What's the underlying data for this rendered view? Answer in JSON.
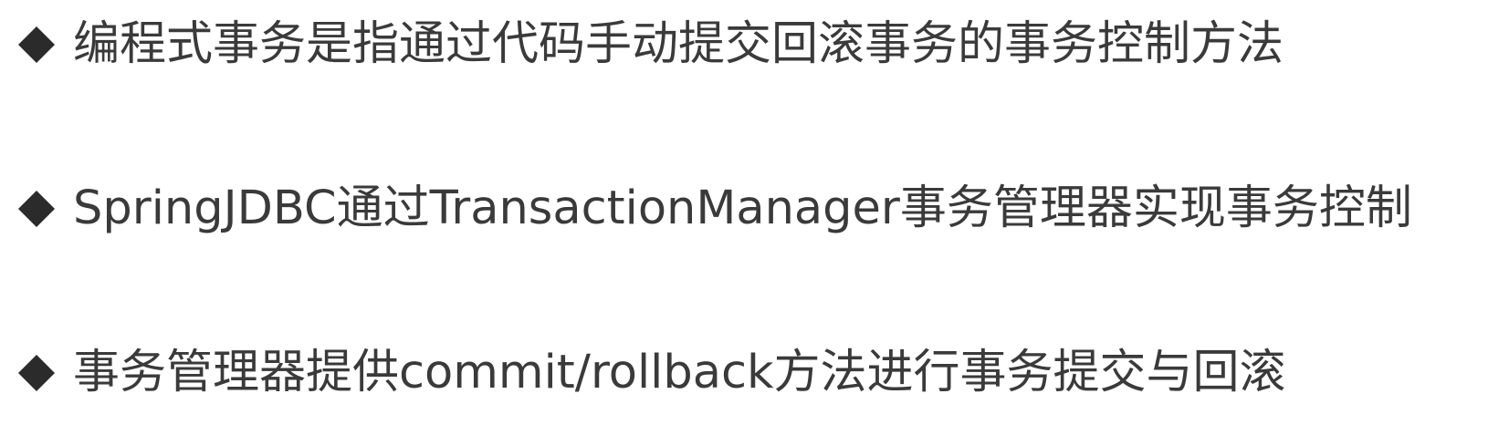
{
  "slide": {
    "bullets": [
      {
        "text": "编程式事务是指通过代码手动提交回滚事务的事务控制方法",
        "icon": "diamond-bullet-icon"
      },
      {
        "text": "SpringJDBC通过TransactionManager事务管理器实现事务控制",
        "icon": "diamond-bullet-icon"
      },
      {
        "text": "事务管理器提供commit/rollback方法进行事务提交与回滚",
        "icon": "diamond-bullet-icon"
      }
    ]
  },
  "colors": {
    "text": "#3a3a3a",
    "bullet": "#2b2b2b",
    "background": "#ffffff"
  }
}
